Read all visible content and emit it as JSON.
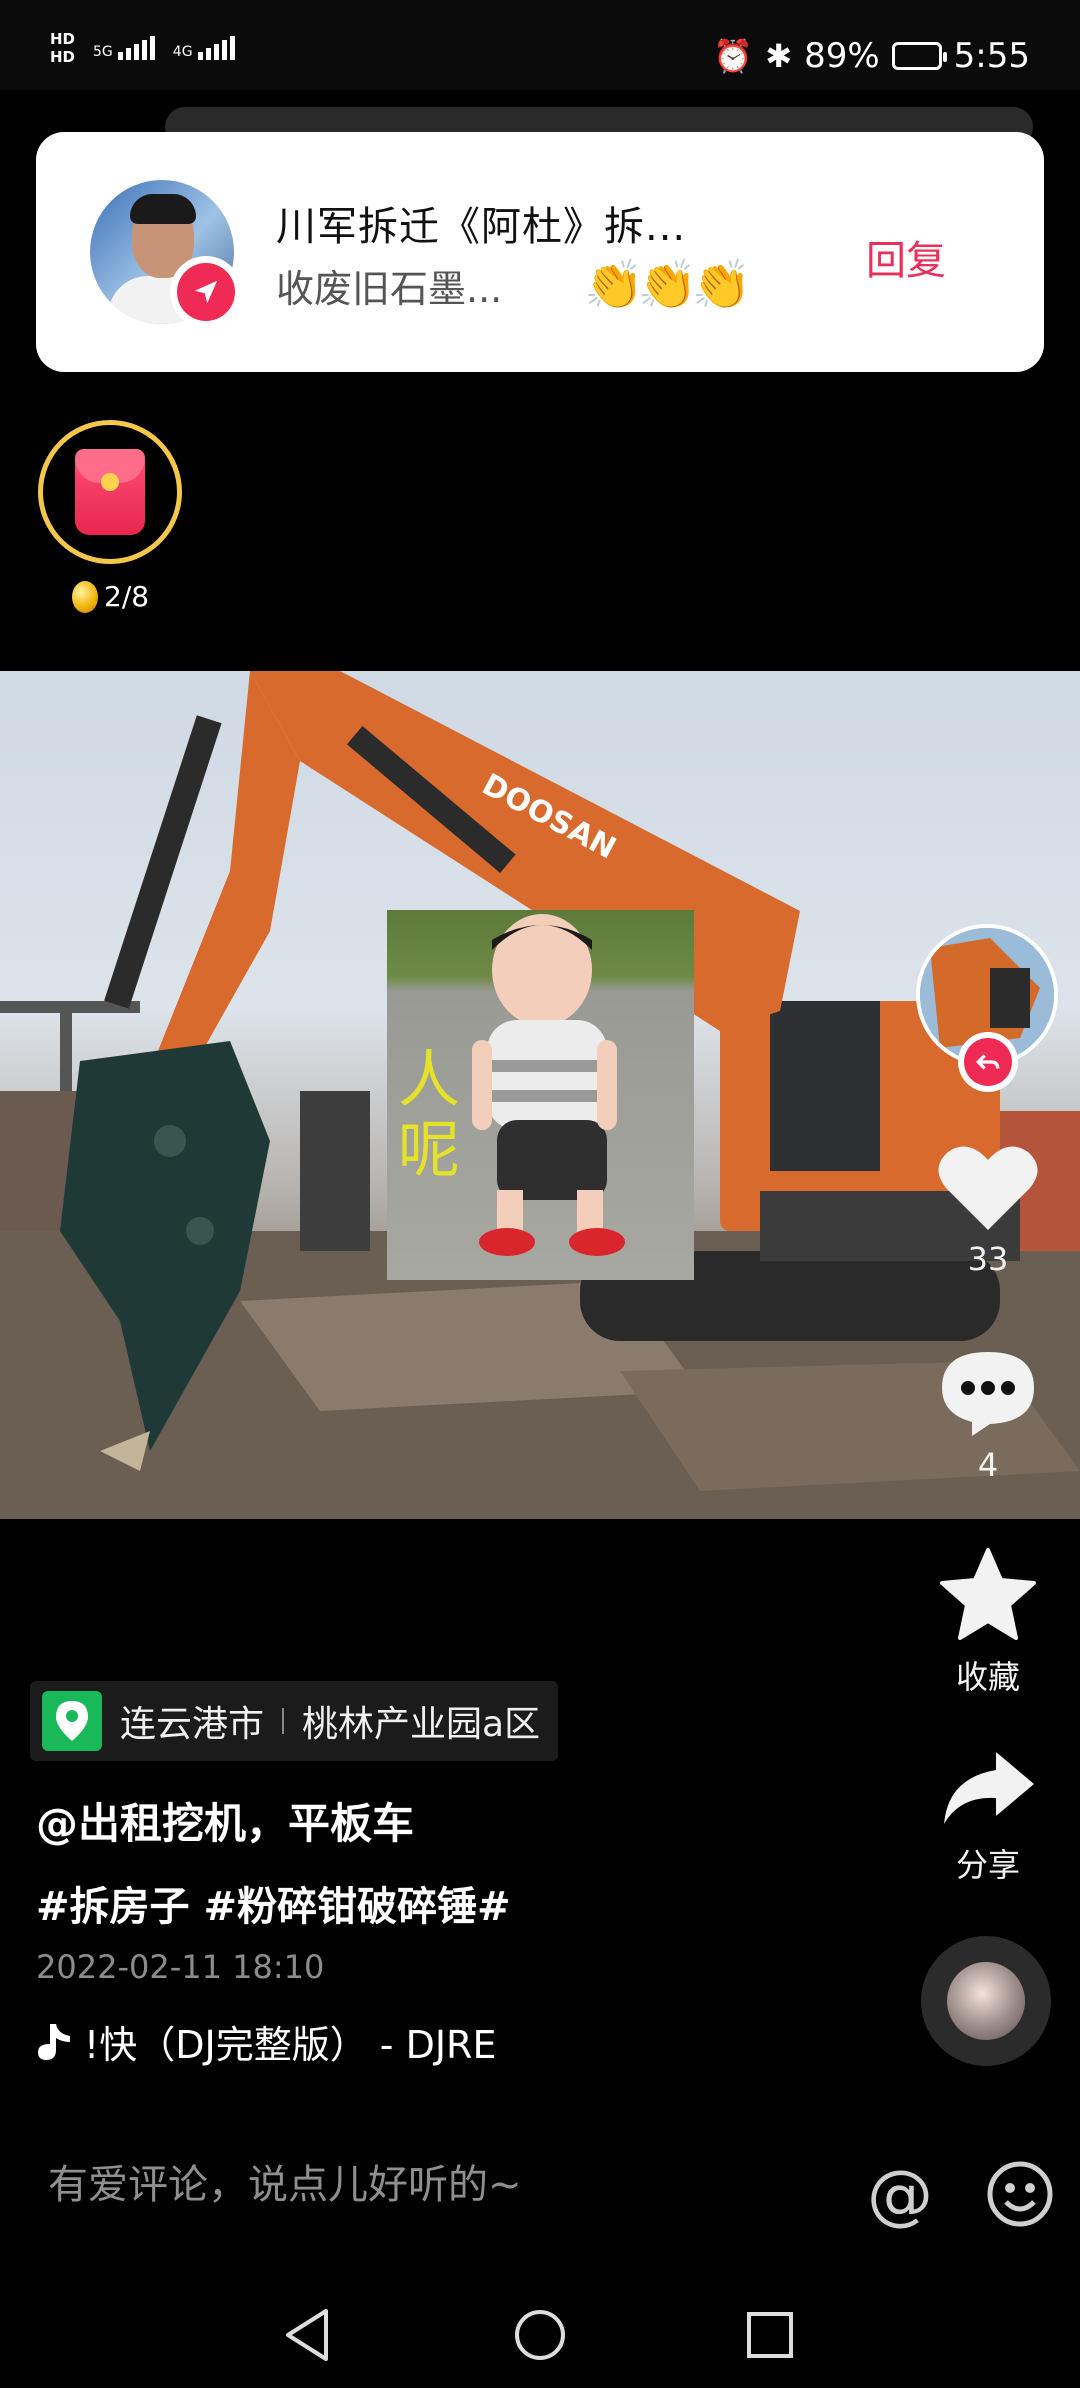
{
  "status_bar": {
    "hd1": "HD",
    "hd2": "HD",
    "net1": "5G",
    "net2": "4G",
    "battery": "89%",
    "time": "5:55"
  },
  "notification": {
    "title": "川军拆迁《阿杜》拆...",
    "body": "收废旧石墨...",
    "emoji": "👏👏👏",
    "reply_label": "回复"
  },
  "red_packet": {
    "progress": "2/8"
  },
  "video": {
    "overlay_text": "人呢",
    "brand_text": "DOOSAN"
  },
  "actions": {
    "like_count": "33",
    "comment_count": "4",
    "favorite_label": "收藏",
    "share_label": "分享"
  },
  "post": {
    "location_city": "连云港市",
    "location_place": "桃林产业园a区",
    "username": "@出租挖机，平板车",
    "hashtags": "#拆房子 #粉碎钳破碎锤#",
    "datetime": "2022-02-11 18:10",
    "music": "!快（DJ完整版） - DJRE"
  },
  "comment_bar": {
    "placeholder": "有爱评论，说点儿好听的~"
  },
  "colors": {
    "accent": "#ef2a55",
    "location_green": "#19b95a",
    "ring_gold": "#f4c64a"
  },
  "icons": [
    "send-icon",
    "red-packet-icon",
    "heart-icon",
    "comment-icon",
    "star-icon",
    "share-icon",
    "music-note-icon",
    "at-icon",
    "emoji-icon",
    "location-pin-icon",
    "back-icon",
    "home-icon",
    "recents-icon"
  ]
}
